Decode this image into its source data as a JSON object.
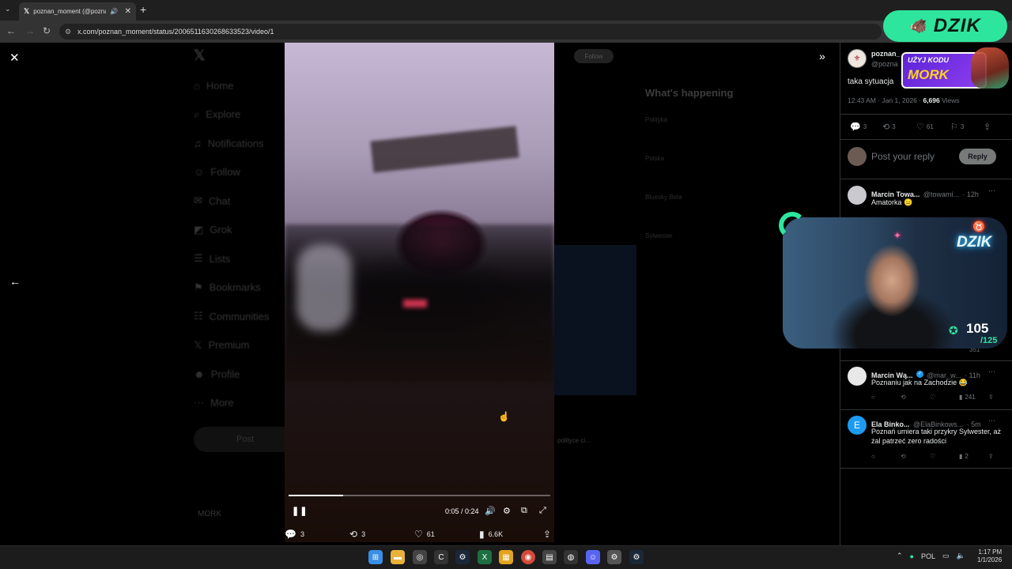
{
  "browser": {
    "tab_title": "poznan_moment (@poznan",
    "url": "x.com/poznan_moment/status/2006511630268633523/video/1"
  },
  "background_nav": [
    "Home",
    "Explore",
    "Notifications",
    "Follow",
    "Chat",
    "Grok",
    "Lists",
    "Bookmarks",
    "Communities",
    "Premium",
    "Profile",
    "More"
  ],
  "background_post_label": "Post",
  "background_follow_label": "Follow",
  "background_right": {
    "title": "What's happening",
    "trends": [
      "Polityka",
      "Polska",
      "Bluesky Beta",
      "Sylwester"
    ]
  },
  "background_user": "MORK",
  "background_snippet": "polityce ci…",
  "video": {
    "time": "0:05 / 0:24",
    "progress": 0.2083,
    "stats": {
      "replies": "3",
      "reposts": "3",
      "likes": "61",
      "views": "6.6K"
    }
  },
  "post": {
    "name": "poznan_",
    "handle": "@pozna",
    "text": "taka sytuacja",
    "time": "12:43 AM · Jan 1, 2026 · ",
    "views_count": "6,696",
    "views_label": " Views",
    "stats": {
      "replies": "3",
      "reposts": "3",
      "likes": "61",
      "bookmarks": "3"
    }
  },
  "reply_box": {
    "placeholder": "Post your reply",
    "button": "Reply"
  },
  "replies": [
    {
      "name": "Marcin Towa...",
      "handle": "@towami...",
      "time": "· 12h",
      "text": "Amatorka 😑",
      "avatar_color": "#c9c9cf",
      "views": ""
    },
    {
      "name": "Marcin Wą...",
      "handle": "@mar_w...",
      "time": "· 11h",
      "text": "Poznaniu jak na Zachodzie 😂",
      "avatar_color": "#e8e8e8",
      "views": "241"
    },
    {
      "name": "Ela Binko...",
      "handle": "@ElaBinkows...",
      "time": "· 5m",
      "text": "Poznań umiera taki przykry Sylwester, aż żal patrzeć zero radości",
      "avatar_color": "#1d9bf0",
      "avatar_letter": "E",
      "views": "2"
    }
  ],
  "hidden_reply_views": "351",
  "overlay": {
    "banner": "DZIK",
    "promo_line1": "UŻYJ KODU",
    "promo_line2": "MORK",
    "webcam_neon": "DZIK",
    "count": "105",
    "count_total": "/125"
  },
  "taskbar": {
    "lang": "POL",
    "time": "1:17 PM",
    "date": "1/1/2026"
  },
  "colors": {
    "accent_green": "#2ee59d",
    "x_blue": "#1d9bf0",
    "promo_purple": "#7a34e8"
  }
}
